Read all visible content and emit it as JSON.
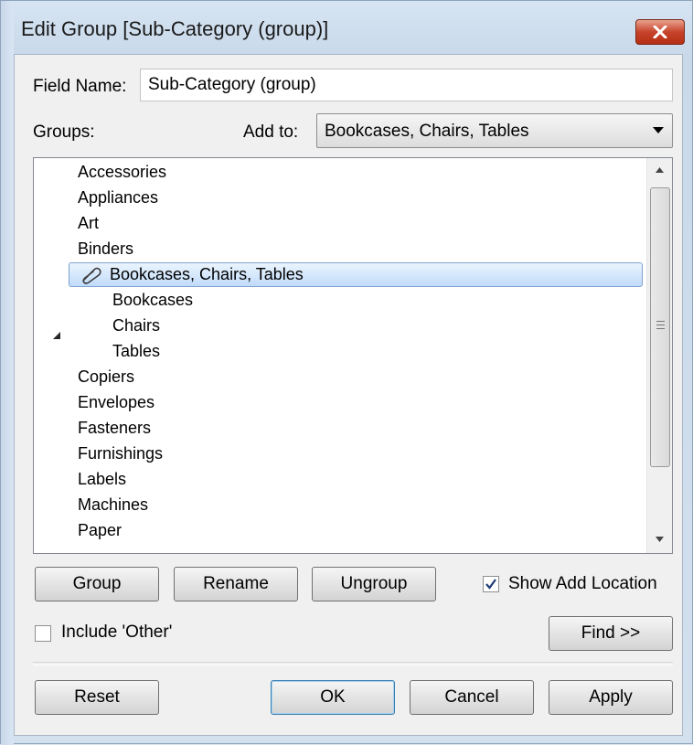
{
  "window": {
    "title": "Edit Group [Sub-Category (group)]"
  },
  "field_name": {
    "label": "Field Name:",
    "value": "Sub-Category (group)"
  },
  "groups": {
    "label": "Groups:",
    "add_to_label": "Add to:",
    "add_to_value": "Bookcases, Chairs, Tables"
  },
  "tree": {
    "items_before": [
      "Accessories",
      "Appliances",
      "Art",
      "Binders"
    ],
    "selected_group": "Bookcases, Chairs, Tables",
    "children": [
      "Bookcases",
      "Chairs",
      "Tables"
    ],
    "items_after": [
      "Copiers",
      "Envelopes",
      "Fasteners",
      "Furnishings",
      "Labels",
      "Machines",
      "Paper"
    ]
  },
  "buttons": {
    "group": "Group",
    "rename": "Rename",
    "ungroup": "Ungroup",
    "find": "Find >>",
    "reset": "Reset",
    "ok": "OK",
    "cancel": "Cancel",
    "apply": "Apply"
  },
  "options": {
    "show_add_location": {
      "label": "Show Add Location",
      "checked": true
    },
    "include_other": {
      "label": "Include 'Other'",
      "checked": false
    }
  },
  "colors": {
    "close_button": "#c7432b",
    "selection": "#c1dcfc",
    "selection_border": "#7da2ce"
  },
  "icons": {
    "group_item": "paperclip-icon",
    "expander": "expanded-triangle-icon",
    "close": "close-icon"
  }
}
